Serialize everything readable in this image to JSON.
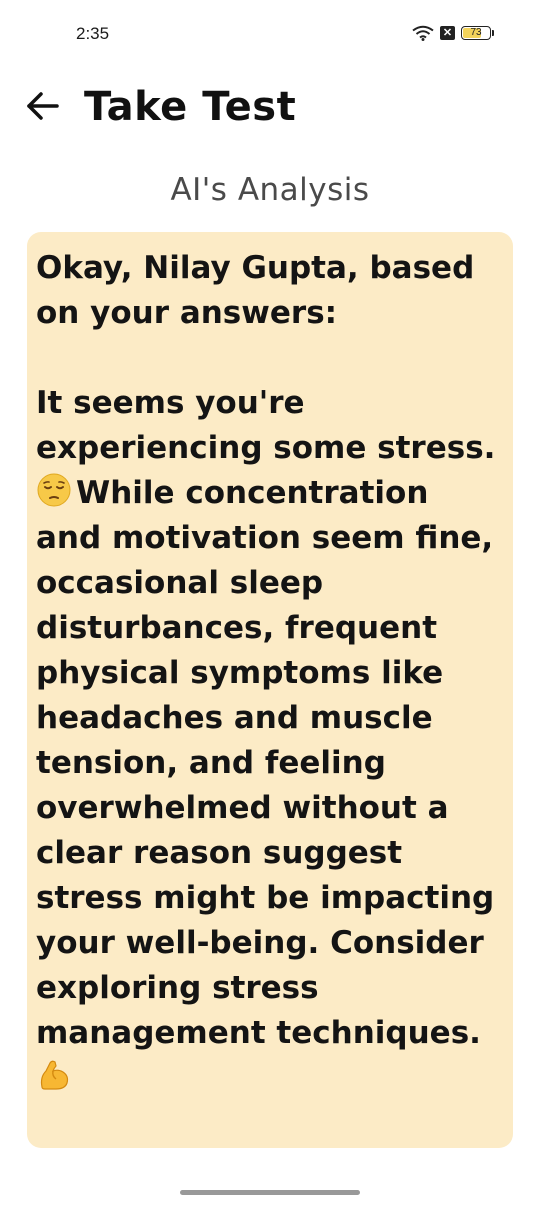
{
  "status_bar": {
    "time": "2:35",
    "battery_level": "73",
    "battery_fraction": 0.73,
    "icons": [
      "wifi-icon",
      "notification-x-icon",
      "battery-icon"
    ]
  },
  "app_bar": {
    "title": "Take Test",
    "back_icon": "arrow-left-icon"
  },
  "section": {
    "heading": "AI's Analysis"
  },
  "analysis": {
    "greeting": "Okay, Nilay Gupta, based on your answers:",
    "para_before_emoji": "It seems you're experiencing some stress.",
    "emoji_1": "pensive-face-emoji",
    "para_after_emoji": "While concentration and motivation seem fine, occasional sleep disturbances, frequent physical symptoms like headaches and muscle tension, and feeling overwhelmed without a clear reason suggest stress might be impacting your well-being. Consider exploring stress management techniques.",
    "emoji_2": "flexed-biceps-emoji"
  },
  "colors": {
    "card_background": "#fcebc6",
    "battery_fill": "#f3d35b"
  }
}
